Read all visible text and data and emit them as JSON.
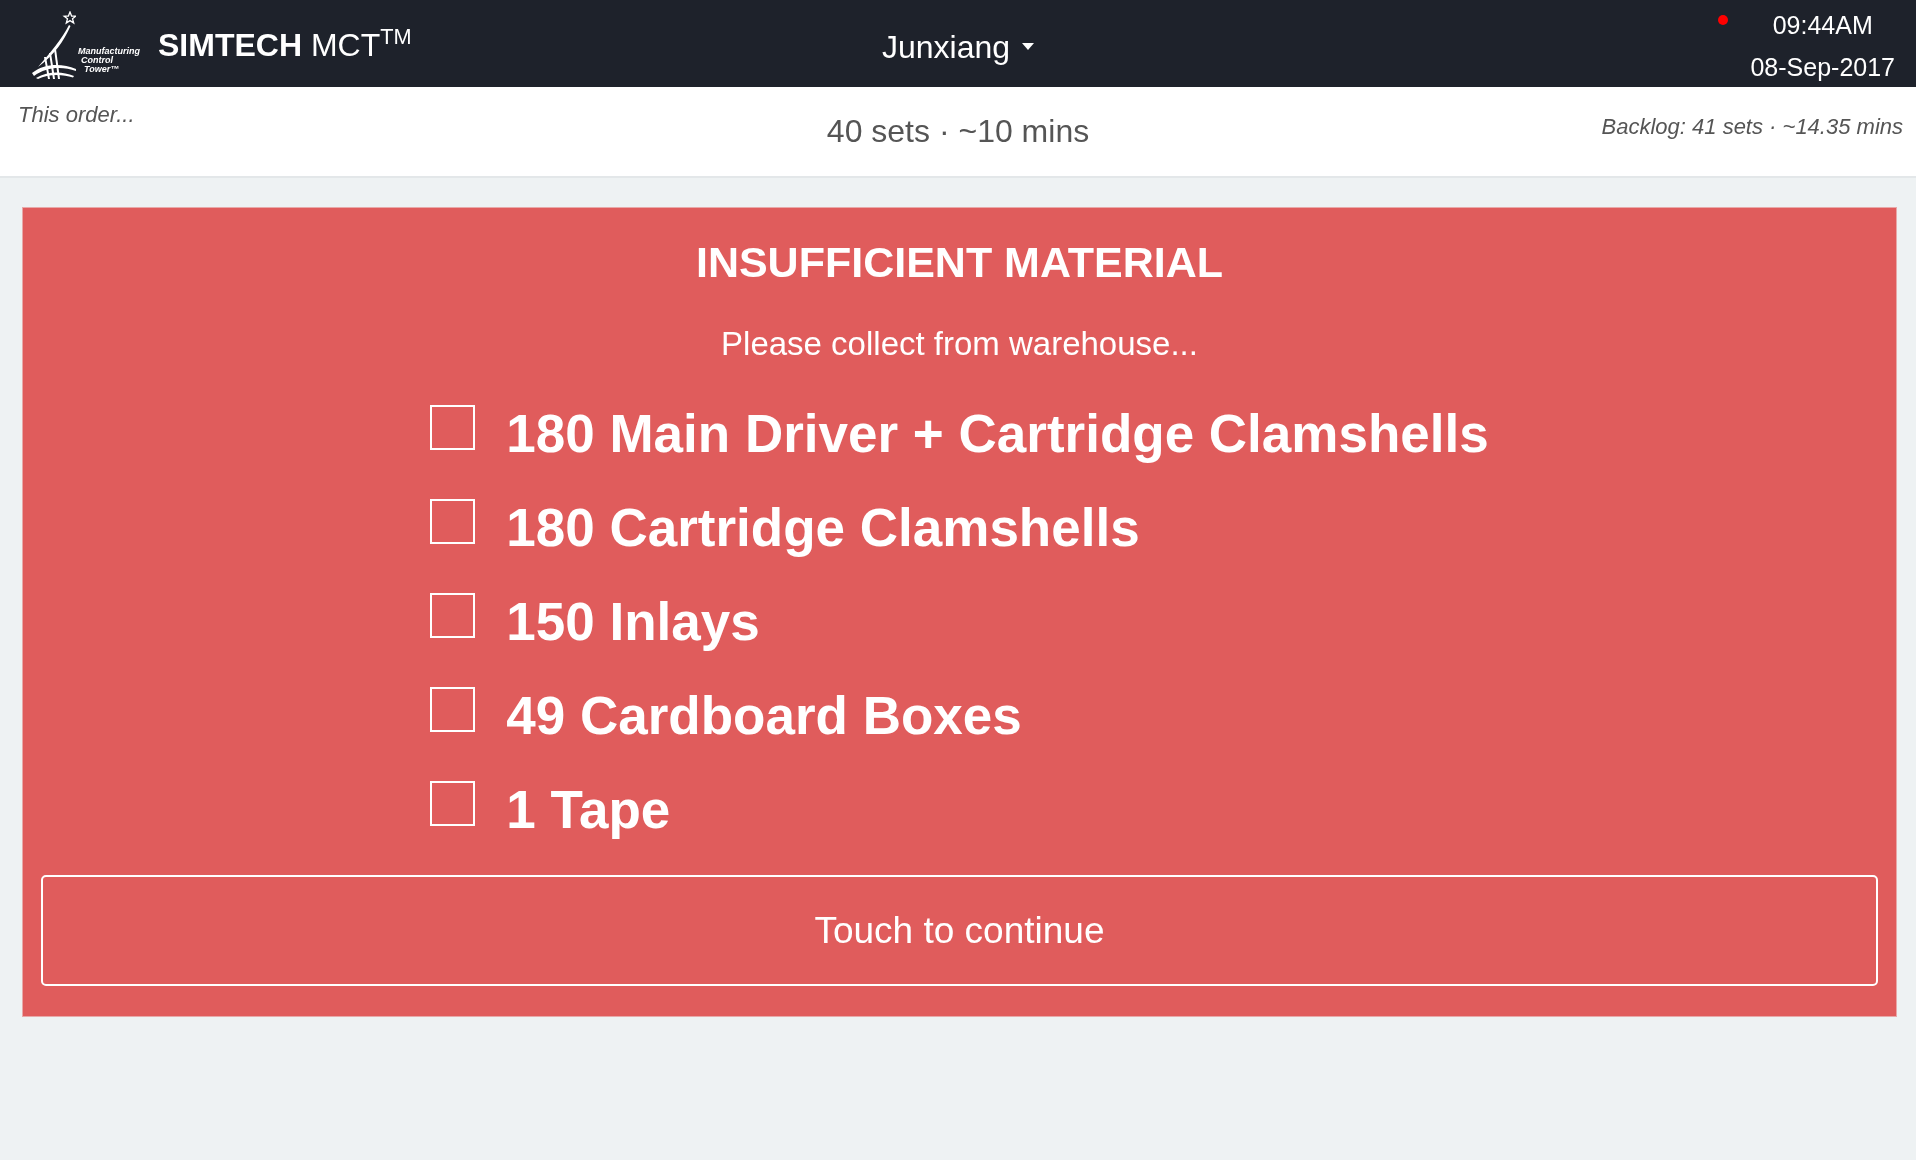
{
  "header": {
    "logo": {
      "lines": [
        "Manufacturing",
        "Control",
        "Tower™"
      ]
    },
    "title": "**SIMTECH** MCT$^{TM}$",
    "user_menu": {
      "label": "Junxiang"
    },
    "indicator": {
      "color": "#ff0000"
    },
    "time": "09:44AM",
    "date": "08-Sep-2017"
  },
  "summary_bar": {
    "order_label": "This order...",
    "order": "40 sets · ~10 mins",
    "backlog": "Backlog: 41 sets · ~14.35 mins"
  },
  "alert": {
    "title": "INSUFFICIENT MATERIAL",
    "message": "Please collect from warehouse...",
    "items": [
      {
        "label": "180 Main Driver + Cartridge Clamshells",
        "checked": false
      },
      {
        "label": "180 Cartridge Clamshells",
        "checked": false
      },
      {
        "label": "150 Inlays",
        "checked": false
      },
      {
        "label": "49 Cardboard Boxes",
        "checked": false
      },
      {
        "label": "1 Tape",
        "checked": false
      }
    ],
    "button": "Touch to continue"
  }
}
